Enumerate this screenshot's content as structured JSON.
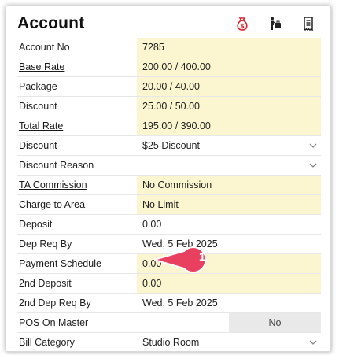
{
  "title": "Account",
  "header_icons": [
    {
      "name": "money-bag-icon",
      "color": "#d9232d"
    },
    {
      "name": "person-luggage-icon",
      "color": "#222222"
    },
    {
      "name": "receipt-icon",
      "color": "#222222"
    }
  ],
  "rows": [
    {
      "label": "Account No",
      "value": "7285"
    },
    {
      "label": "Base Rate",
      "value": "200.00 / 400.00"
    },
    {
      "label": "Package",
      "value": "20.00 / 40.00"
    },
    {
      "label": "Discount",
      "value": "25.00 / 50.00"
    },
    {
      "label": "Total Rate",
      "value": "195.00 / 390.00"
    },
    {
      "label": "Discount",
      "value": "$25 Discount"
    },
    {
      "label": "Discount Reason",
      "value": ""
    },
    {
      "label": "TA Commission",
      "value": "No Commission"
    },
    {
      "label": "Charge to Area",
      "value": "No Limit"
    },
    {
      "label": "Deposit",
      "value": "0.00"
    },
    {
      "label": "Dep Req By",
      "value": "Wed, 5 Feb 2025"
    },
    {
      "label": "Payment Schedule",
      "value": "0.00"
    },
    {
      "label": "2nd Deposit",
      "value": "0.00"
    },
    {
      "label": "2nd Dep Req By",
      "value": "Wed, 5 Feb 2025"
    },
    {
      "label": "POS On Master",
      "value": "",
      "toggle": "No"
    },
    {
      "label": "Bill Category",
      "value": "Studio Room"
    }
  ],
  "callout": {
    "number": "1",
    "color": "#e8405e"
  },
  "colors": {
    "highlight": "#fbf6cf",
    "toggle_bg": "#e9e9e9"
  }
}
